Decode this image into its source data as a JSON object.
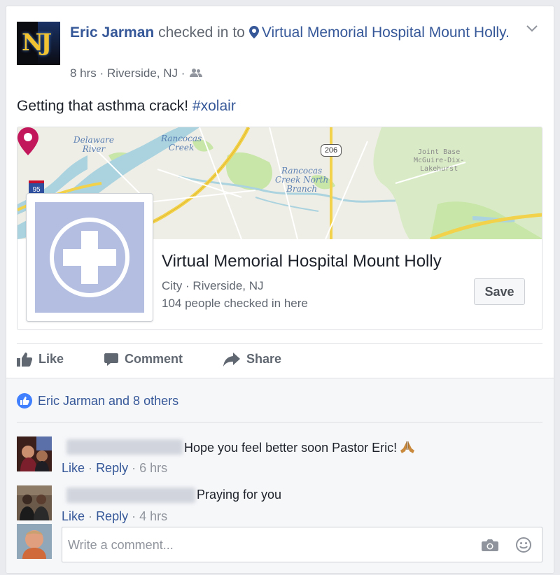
{
  "post": {
    "author": "Eric Jarman",
    "action_text": "checked in to",
    "place_link": "Virtual Memorial Hospital Mount Holly",
    "place_suffix": ".",
    "time": "8 hrs",
    "sep1": "·",
    "location": "Riverside, NJ",
    "sep2": "·",
    "audience_icon": "friends-icon",
    "message": "Getting that asthma crack! ",
    "hashtag": "#xolair"
  },
  "map": {
    "labels": {
      "delaware": "Delaware\nRiver",
      "rancocas_creek": "Rancocas\nCreek",
      "rancocas_north": "Rancocas\nCreek North\nBranch",
      "joint_base": "Joint Base\nMcGuire-Dix-\nLakehurst",
      "route_206": "206",
      "route_95": "95"
    },
    "colors": {
      "water": "#aad3df",
      "park": "#c8e6a8",
      "highway": "#f2d24a",
      "pin": "#c2185b"
    }
  },
  "place_card": {
    "name": "Virtual Memorial Hospital Mount Holly",
    "category": "City",
    "sep": "·",
    "location": "Riverside, NJ",
    "checkins": "104 people checked in here",
    "save_label": "Save"
  },
  "actions": {
    "like": "Like",
    "comment": "Comment",
    "share": "Share"
  },
  "likes": {
    "summary": "Eric Jarman and 8 others"
  },
  "comments": [
    {
      "text": "Hope you feel better soon Pastor Eric!",
      "like": "Like",
      "reply": "Reply",
      "sep": "·",
      "time": "6 hrs"
    },
    {
      "text": "Praying for you",
      "like": "Like",
      "reply": "Reply",
      "sep": "·",
      "time": "4 hrs"
    }
  ],
  "composer": {
    "placeholder": "Write a comment..."
  },
  "colors": {
    "link": "#365899",
    "accent": "#4080ff",
    "muted": "#616770"
  }
}
